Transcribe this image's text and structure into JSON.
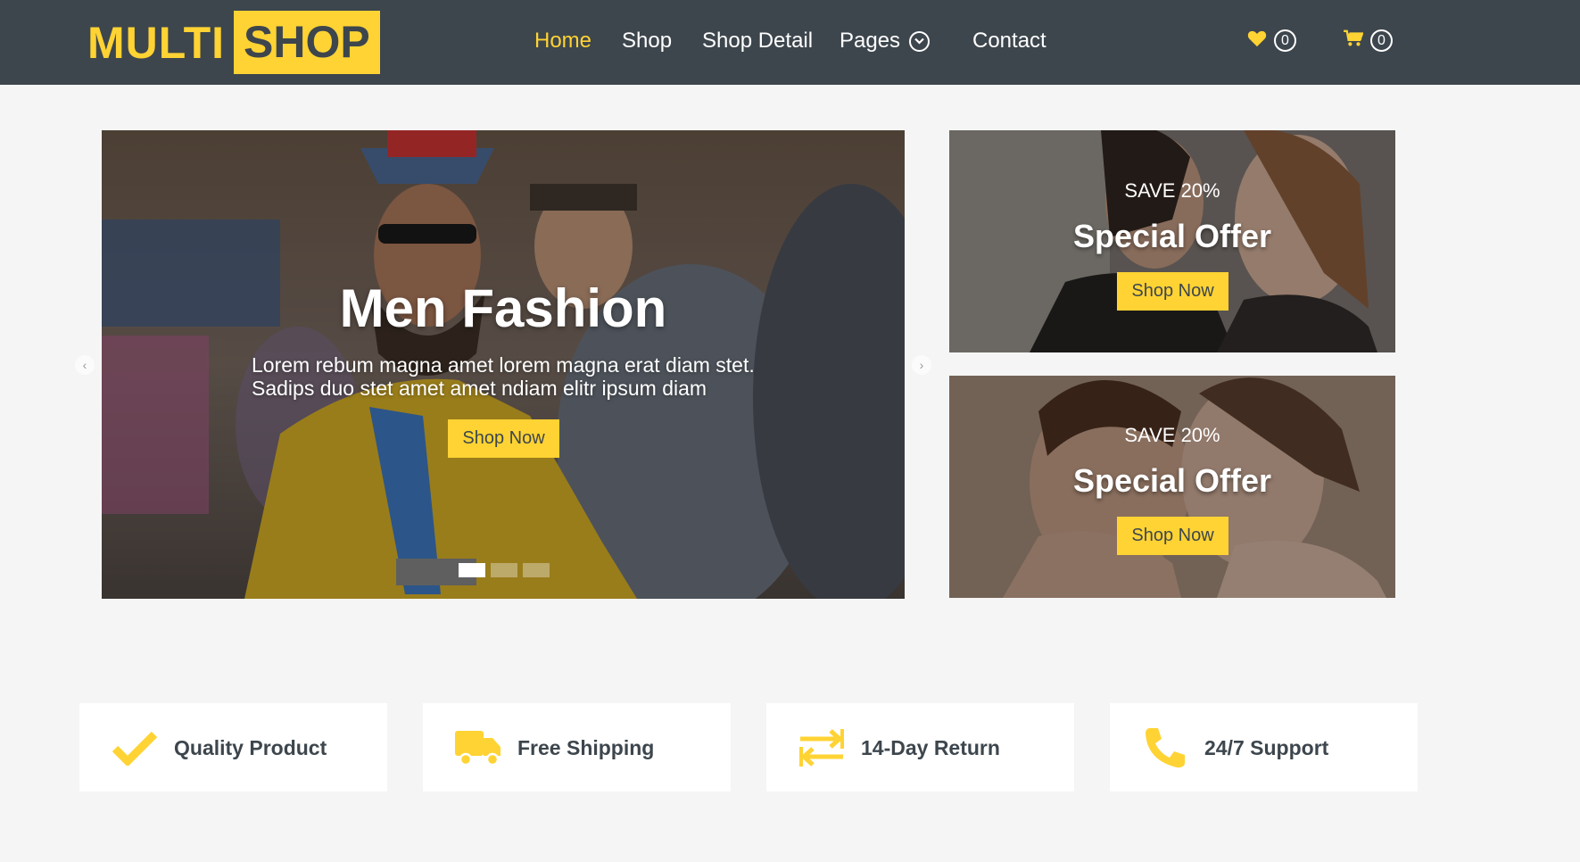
{
  "brand": {
    "part1": "MULTI",
    "part2": "SHOP"
  },
  "nav": {
    "items": [
      {
        "label": "Home",
        "active": true
      },
      {
        "label": "Shop"
      },
      {
        "label": "Shop Detail"
      },
      {
        "label": "Pages",
        "has_dropdown": true
      },
      {
        "label": "Contact"
      }
    ],
    "wishlist": {
      "icon": "heart-icon",
      "count": "0"
    },
    "cart": {
      "icon": "cart-icon",
      "count": "0"
    }
  },
  "carousel": {
    "title": "Men Fashion",
    "text": "Lorem rebum magna amet lorem magna erat diam stet. Sadips duo stet amet amet ndiam elitr ipsum diam",
    "button": "Shop Now",
    "slides": 3,
    "active_slide": 1
  },
  "offers": [
    {
      "save": "SAVE 20%",
      "title": "Special Offer",
      "button": "Shop Now"
    },
    {
      "save": "SAVE 20%",
      "title": "Special Offer",
      "button": "Shop Now"
    }
  ],
  "features": [
    {
      "icon": "check-icon",
      "label": "Quality Product"
    },
    {
      "icon": "truck-icon",
      "label": "Free Shipping"
    },
    {
      "icon": "exchange-icon",
      "label": "14-Day Return"
    },
    {
      "icon": "phone-icon",
      "label": "24/7 Support"
    }
  ],
  "colors": {
    "accent": "#ffd333",
    "dark": "#3d464d",
    "background": "#f5f5f5"
  }
}
